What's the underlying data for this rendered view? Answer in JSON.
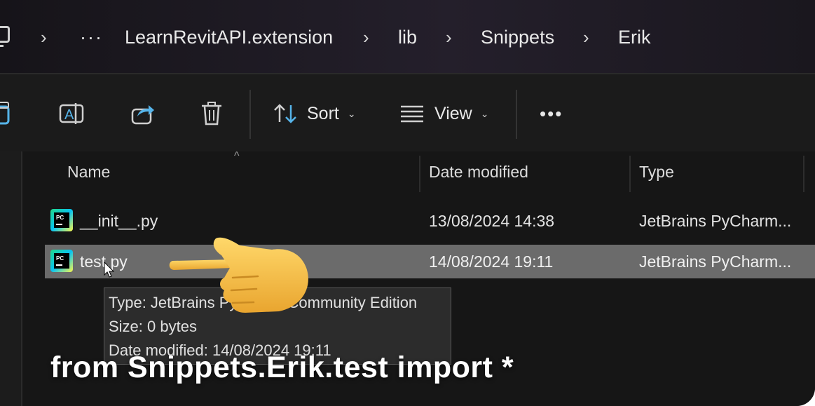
{
  "breadcrumb": {
    "more": "···",
    "items": [
      "LearnRevitAPI.extension",
      "lib",
      "Snippets",
      "Erik"
    ]
  },
  "toolbar": {
    "sort_label": "Sort",
    "view_label": "View",
    "more": "•••"
  },
  "columns": {
    "name": "Name",
    "date": "Date modified",
    "type": "Type"
  },
  "files": [
    {
      "name": "__init__.py",
      "date": "13/08/2024 14:38",
      "type": "JetBrains PyCharm..."
    },
    {
      "name": "test.py",
      "date": "14/08/2024 19:11",
      "type": "JetBrains PyCharm..."
    }
  ],
  "tooltip": {
    "type_line": "Type: JetBrains PyCharm Community Edition",
    "size_line": "Size: 0 bytes",
    "date_line": "Date modified: 14/08/2024 19:11"
  },
  "caption": "from Snippets.Erik.test import *",
  "colors": {
    "selection": "#6b6b6b",
    "background": "#161616",
    "hand": "#f6c34a"
  }
}
